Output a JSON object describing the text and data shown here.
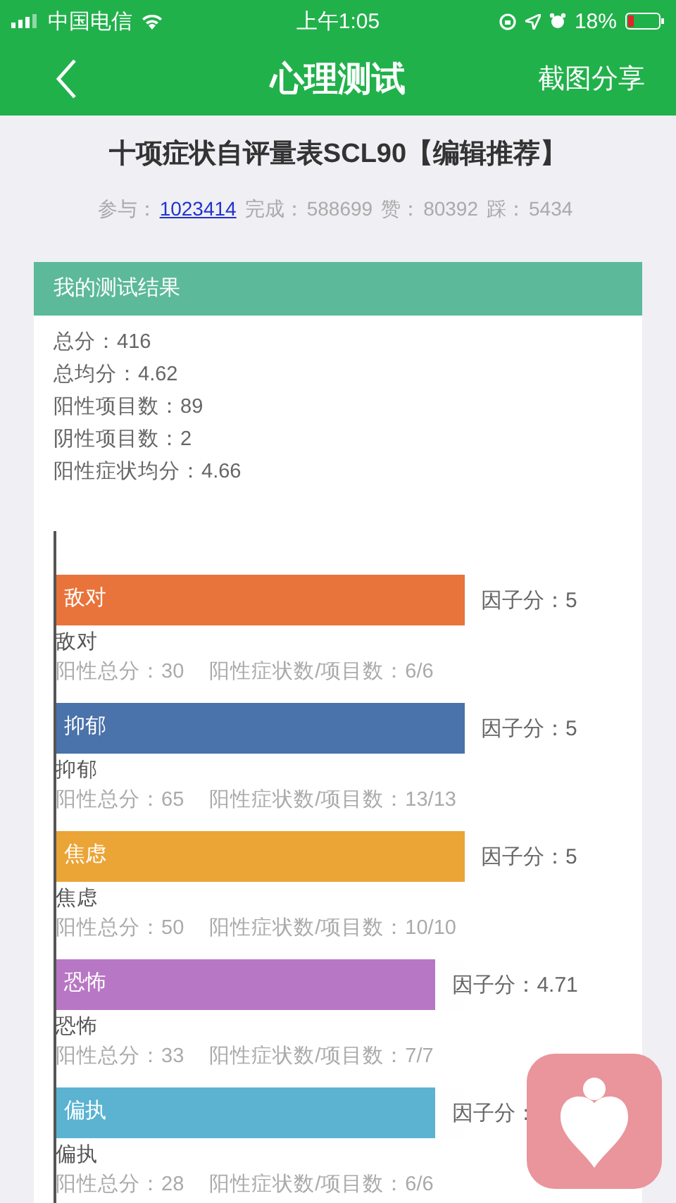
{
  "status_bar": {
    "carrier": "中国电信",
    "time": "上午1:05",
    "battery": "18%"
  },
  "nav": {
    "title": "心理测试",
    "action": "截图分享"
  },
  "test": {
    "title": "十项症状自评量表SCL90【编辑推荐】",
    "stats": [
      {
        "label": "参与：",
        "value": "1023414",
        "link": true
      },
      {
        "label": "完成：",
        "value": "588699",
        "link": false
      },
      {
        "label": "赞：",
        "value": "80392",
        "link": false
      },
      {
        "label": "踩：",
        "value": "5434",
        "link": false
      }
    ]
  },
  "result": {
    "header": "我的测试结果",
    "summary": [
      "总分：416",
      "总均分：4.62",
      "阳性项目数：89",
      "阴性项目数：2",
      "阳性症状均分：4.66"
    ],
    "factors": [
      {
        "bar_label": "敌对",
        "color": "#e8743b",
        "level": 1,
        "score": "因子分：5",
        "name": "敌对",
        "positive_total": "阳性总分：30",
        "ratio": "阳性症状数/项目数：6/6"
      },
      {
        "bar_label": "抑郁",
        "color": "#4a72ab",
        "level": 1,
        "score": "因子分：5",
        "name": "抑郁",
        "positive_total": "阳性总分：65",
        "ratio": "阳性症状数/项目数：13/13"
      },
      {
        "bar_label": "焦虑",
        "color": "#eba436",
        "level": 1,
        "score": "因子分：5",
        "name": "焦虑",
        "positive_total": "阳性总分：50",
        "ratio": "阳性症状数/项目数：10/10"
      },
      {
        "bar_label": "恐怖",
        "color": "#b877c4",
        "level": 0.93,
        "score": "因子分：4.71",
        "name": "恐怖",
        "positive_total": "阳性总分：33",
        "ratio": "阳性症状数/项目数：7/7"
      },
      {
        "bar_label": "偏执",
        "color": "#5bb3d1",
        "level": 0.93,
        "score": "因子分：",
        "name": "偏执",
        "positive_total": "阳性总分：28",
        "ratio": "阳性症状数/项目数：6/6"
      }
    ]
  }
}
